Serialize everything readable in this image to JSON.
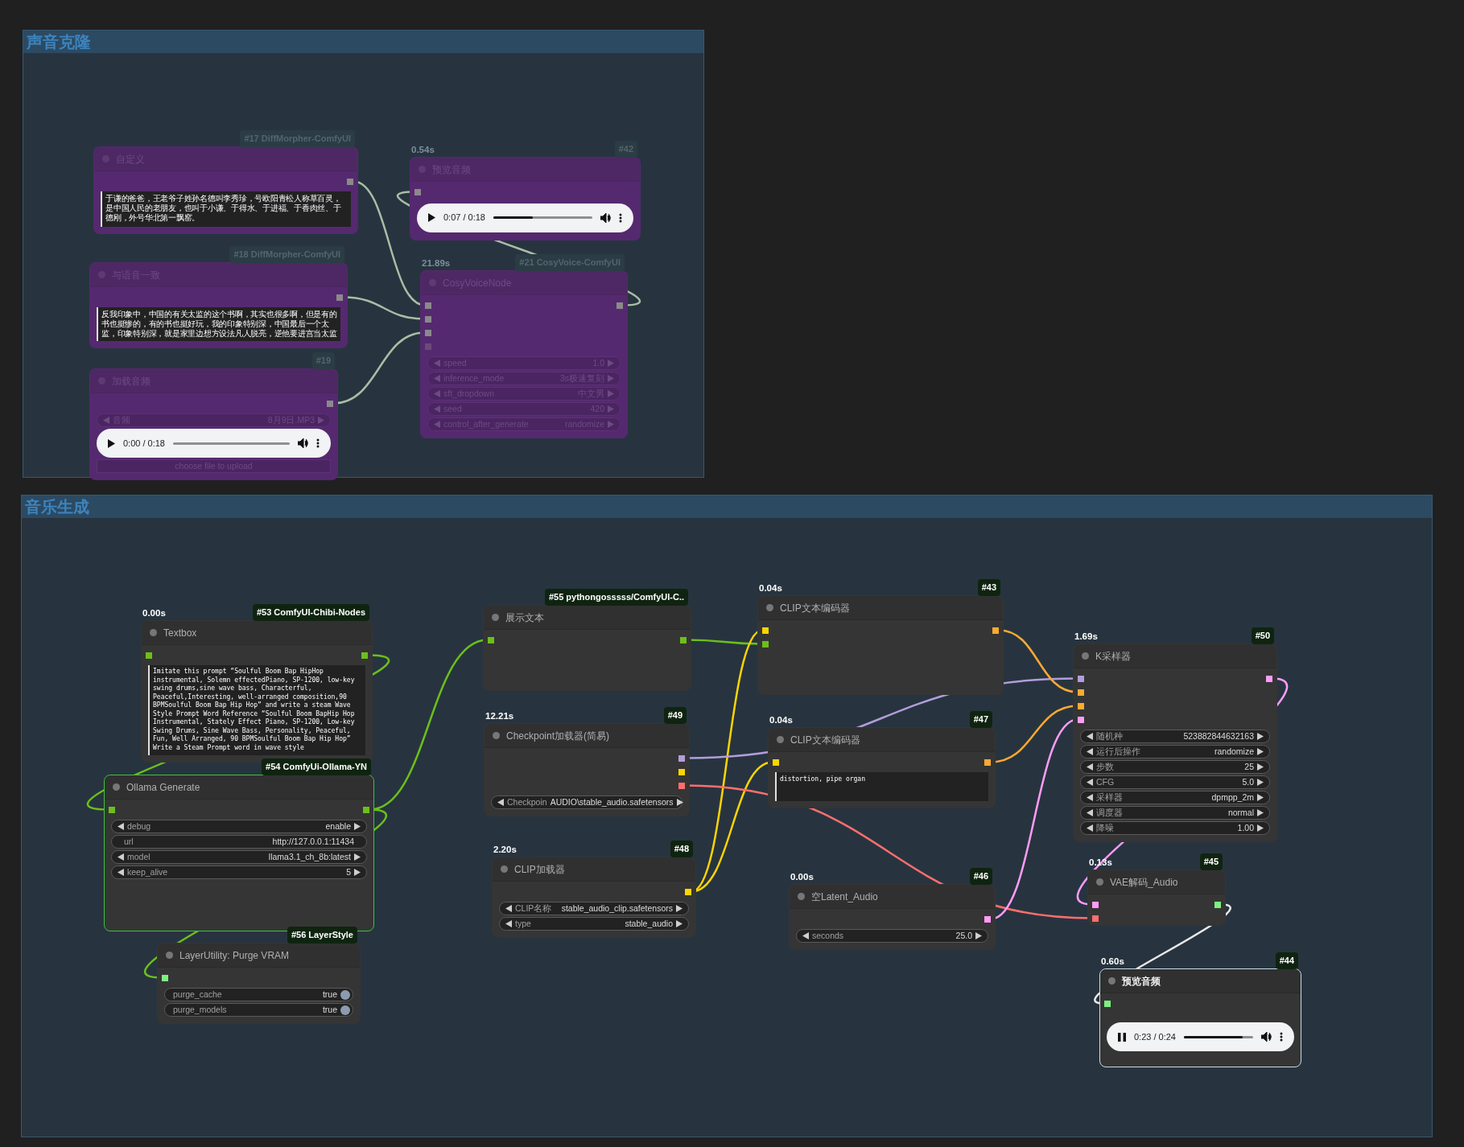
{
  "groups": [
    {
      "title": "声音克隆",
      "nodes": [
        {
          "badge": "#17 DiffMorpher-ComfyUI",
          "title": "自定义",
          "bypassed": true,
          "executing": false,
          "selected": false,
          "outputs": [
            {
              "color": "#8a8a8a"
            }
          ],
          "widgets": [
            {
              "kind": "textarea",
              "value": "于谦的爸爸，王老爷子姓孙名德叫李秀珍，号欧阳青松人称草百灵，是中国人民的老朋友，也叫于小谦、于得水、于进福、于香肉丝、于德刚，外号华北第一飘窑。"
            }
          ]
        },
        {
          "badge": "#18 DiffMorpher-ComfyUI",
          "title": "与语音一致",
          "bypassed": true,
          "executing": false,
          "selected": false,
          "outputs": [
            {
              "color": "#8a8a8a"
            }
          ],
          "widgets": [
            {
              "kind": "textarea",
              "value": "反我印象中，中国的有关太监的这个书啊，其实也很多啊，但是有的书也挺惨的，有的书也挺好玩，我的印象特别深，中国最后一个太监，印象特别深，就是家里边想方设法凡人脱亮，逆他要进宫当太监"
            }
          ]
        },
        {
          "badge": "#19",
          "title": "加载音频",
          "bypassed": true,
          "executing": false,
          "selected": false,
          "outputs": [
            {
              "color": "#8a8a8a"
            }
          ],
          "widgets": [
            {
              "kind": "stepper",
              "label": "音频",
              "value": "8月9日.MP3"
            },
            {
              "kind": "audio",
              "playing": false,
              "time": "0:00 / 0:18",
              "level": 0
            },
            {
              "kind": "upload",
              "label": "choose file to upload"
            }
          ]
        },
        {
          "time": "0.54s",
          "badge": "#42",
          "title": "预览音频",
          "bypassed": true,
          "executing": false,
          "selected": false,
          "inputs": [
            {
              "color": "#8a8a8a"
            }
          ],
          "widgets": [
            {
              "kind": "audio",
              "playing": false,
              "time": "0:07 / 0:18",
              "level": 0.4
            }
          ]
        },
        {
          "time": "21.89s",
          "badge": "#21 CosyVoice-ComfyUI",
          "title": "CosyVoiceNode",
          "bypassed": true,
          "executing": false,
          "selected": false,
          "inputs": [
            {
              "color": "#8a8a8a"
            },
            {
              "color": "#8a8a8a"
            },
            {
              "color": "#8a8a8a"
            },
            {
              "color": "#6a4a7a"
            }
          ],
          "outputs": [
            {
              "color": "#8a8a8a"
            }
          ],
          "widgets": [
            {
              "kind": "stepper",
              "label": "speed",
              "value": "1.0"
            },
            {
              "kind": "stepper",
              "label": "inference_mode",
              "value": "3s极速复刻"
            },
            {
              "kind": "stepper",
              "label": "sft_dropdown",
              "value": "中文男"
            },
            {
              "kind": "stepper",
              "label": "seed",
              "value": "420"
            },
            {
              "kind": "stepper",
              "label": "control_after_generate",
              "value": "randomize"
            }
          ]
        }
      ]
    },
    {
      "title": "音乐生成",
      "nodes": [
        {
          "time": "0.00s",
          "badge": "#53 ComfyUI-Chibi-Nodes",
          "title": "Textbox",
          "bypassed": false,
          "executing": false,
          "selected": false,
          "inputs": [
            {
              "color": "#6cbf1b"
            }
          ],
          "outputs": [
            {
              "color": "#6cbf1b"
            }
          ],
          "widgets": [
            {
              "kind": "textarea",
              "value": "Imitate this prompt “Soulful Boom Bap HipHop instrumental, Solemn effectedPiano, SP-1200, low-key swing drums,sine wave bass, Characterful, Peaceful,Interesting, well-arranged composition,90 BPMSoulful Boom Bap Hip Hop” and write a steam Wave Style Prompt Word Reference “Soulful Boom BapHip Hop Instrumental, Stately Effect Piano, SP-1200, Low-key Swing Drums, Sine Wave Bass, Personality, Peaceful, Fun, Well Arranged, 90 BPMSoulful Boom Bap Hip Hop” Write a Steam Prompt word in wave style"
            }
          ]
        },
        {
          "badge": "#55 pythongosssss/ComfyUI-C..",
          "title": "展示文本",
          "bypassed": false,
          "executing": false,
          "selected": false,
          "inputs": [
            {
              "color": "#6cbf1b"
            }
          ],
          "outputs": [
            {
              "color": "#6cbf1b"
            }
          ]
        },
        {
          "time": "0.04s",
          "badge": "#43",
          "title": "CLIP文本编码器",
          "bypassed": false,
          "executing": false,
          "selected": false,
          "inputs": [
            {
              "color": "#ffd500"
            },
            {
              "color": "#6cbf1b"
            }
          ],
          "outputs": [
            {
              "color": "#ffa931"
            }
          ]
        },
        {
          "time": "1.69s",
          "badge": "#50",
          "title": "K采样器",
          "bypassed": false,
          "executing": false,
          "selected": false,
          "inputs": [
            {
              "color": "#b39ddb"
            },
            {
              "color": "#ffa931"
            },
            {
              "color": "#ffa931"
            },
            {
              "color": "#ff9cf9"
            }
          ],
          "outputs": [
            {
              "color": "#ff9cf9"
            }
          ],
          "widgets": [
            {
              "kind": "stepper",
              "label": "随机种",
              "value": "523882844632163"
            },
            {
              "kind": "stepper",
              "label": "运行后操作",
              "value": "randomize"
            },
            {
              "kind": "stepper",
              "label": "步数",
              "value": "25"
            },
            {
              "kind": "stepper",
              "label": "CFG",
              "value": "5.0"
            },
            {
              "kind": "stepper",
              "label": "采样器",
              "value": "dpmpp_2m"
            },
            {
              "kind": "stepper",
              "label": "调度器",
              "value": "normal"
            },
            {
              "kind": "stepper",
              "label": "降噪",
              "value": "1.00"
            }
          ]
        },
        {
          "time": "12.21s",
          "badge": "#49",
          "title": "Checkpoint加载器(简易)",
          "bypassed": false,
          "executing": false,
          "selected": false,
          "outputs": [
            {
              "color": "#b39ddb"
            },
            {
              "color": "#ffd500"
            },
            {
              "color": "#ff6e6e"
            }
          ],
          "widgets": [
            {
              "kind": "stepper",
              "label": "Checkpoin",
              "value": "AUDIO\\stable_audio.safetensors"
            }
          ]
        },
        {
          "time": "0.04s",
          "badge": "#47",
          "title": "CLIP文本编码器",
          "bypassed": false,
          "executing": false,
          "selected": false,
          "inputs": [
            {
              "color": "#ffd500"
            }
          ],
          "outputs": [
            {
              "color": "#ffa931"
            }
          ],
          "widgets": [
            {
              "kind": "textarea",
              "value": "distortion, pipe organ"
            }
          ]
        },
        {
          "badge": "#54 ComfyUi-Ollama-YN",
          "title": "Ollama Generate",
          "bypassed": false,
          "executing": true,
          "selected": false,
          "inputs": [
            {
              "color": "#6cbf1b"
            }
          ],
          "outputs": [
            {
              "color": "#6cbf1b"
            }
          ],
          "widgets": [
            {
              "kind": "stepper",
              "label": "debug",
              "value": "enable"
            },
            {
              "kind": "field",
              "label": "url",
              "value": "http://127.0.0.1:11434"
            },
            {
              "kind": "stepper",
              "label": "model",
              "value": "llama3.1_ch_8b:latest"
            },
            {
              "kind": "stepper",
              "label": "keep_alive",
              "value": "5"
            }
          ]
        },
        {
          "time": "2.20s",
          "badge": "#48",
          "title": "CLIP加载器",
          "bypassed": false,
          "executing": false,
          "selected": false,
          "outputs": [
            {
              "color": "#ffd500"
            }
          ],
          "widgets": [
            {
              "kind": "stepper",
              "label": "CLIP名称",
              "value": "stable_audio_clip.safetensors"
            },
            {
              "kind": "stepper",
              "label": "type",
              "value": "stable_audio"
            }
          ]
        },
        {
          "time": "0.00s",
          "badge": "#46",
          "title": "空Latent_Audio",
          "bypassed": false,
          "executing": false,
          "selected": false,
          "outputs": [
            {
              "color": "#ff9cf9"
            }
          ],
          "widgets": [
            {
              "kind": "stepper",
              "label": "seconds",
              "value": "25.0"
            }
          ]
        },
        {
          "time": "0.13s",
          "badge": "#45",
          "title": "VAE解码_Audio",
          "bypassed": false,
          "executing": false,
          "selected": false,
          "inputs": [
            {
              "color": "#ff9cf9"
            },
            {
              "color": "#ff6e6e"
            }
          ],
          "outputs": [
            {
              "color": "#7ef07e"
            }
          ]
        },
        {
          "badge": "#56 LayerStyle",
          "title": "LayerUtility: Purge VRAM",
          "bypassed": false,
          "executing": false,
          "selected": false,
          "inputs": [
            {
              "color": "#7ef07e"
            }
          ],
          "widgets": [
            {
              "kind": "toggle",
              "label": "purge_cache",
              "value": "true",
              "on": true
            },
            {
              "kind": "toggle",
              "label": "purge_models",
              "value": "true",
              "on": true
            }
          ]
        },
        {
          "time": "0.60s",
          "badge": "#44",
          "title": "预览音频",
          "bypassed": false,
          "executing": false,
          "selected": true,
          "inputs": [
            {
              "color": "#7ef07e"
            }
          ],
          "widgets": [
            {
              "kind": "audio",
              "playing": true,
              "time": "0:23 / 0:24",
              "level": 0.85
            }
          ]
        }
      ]
    }
  ]
}
